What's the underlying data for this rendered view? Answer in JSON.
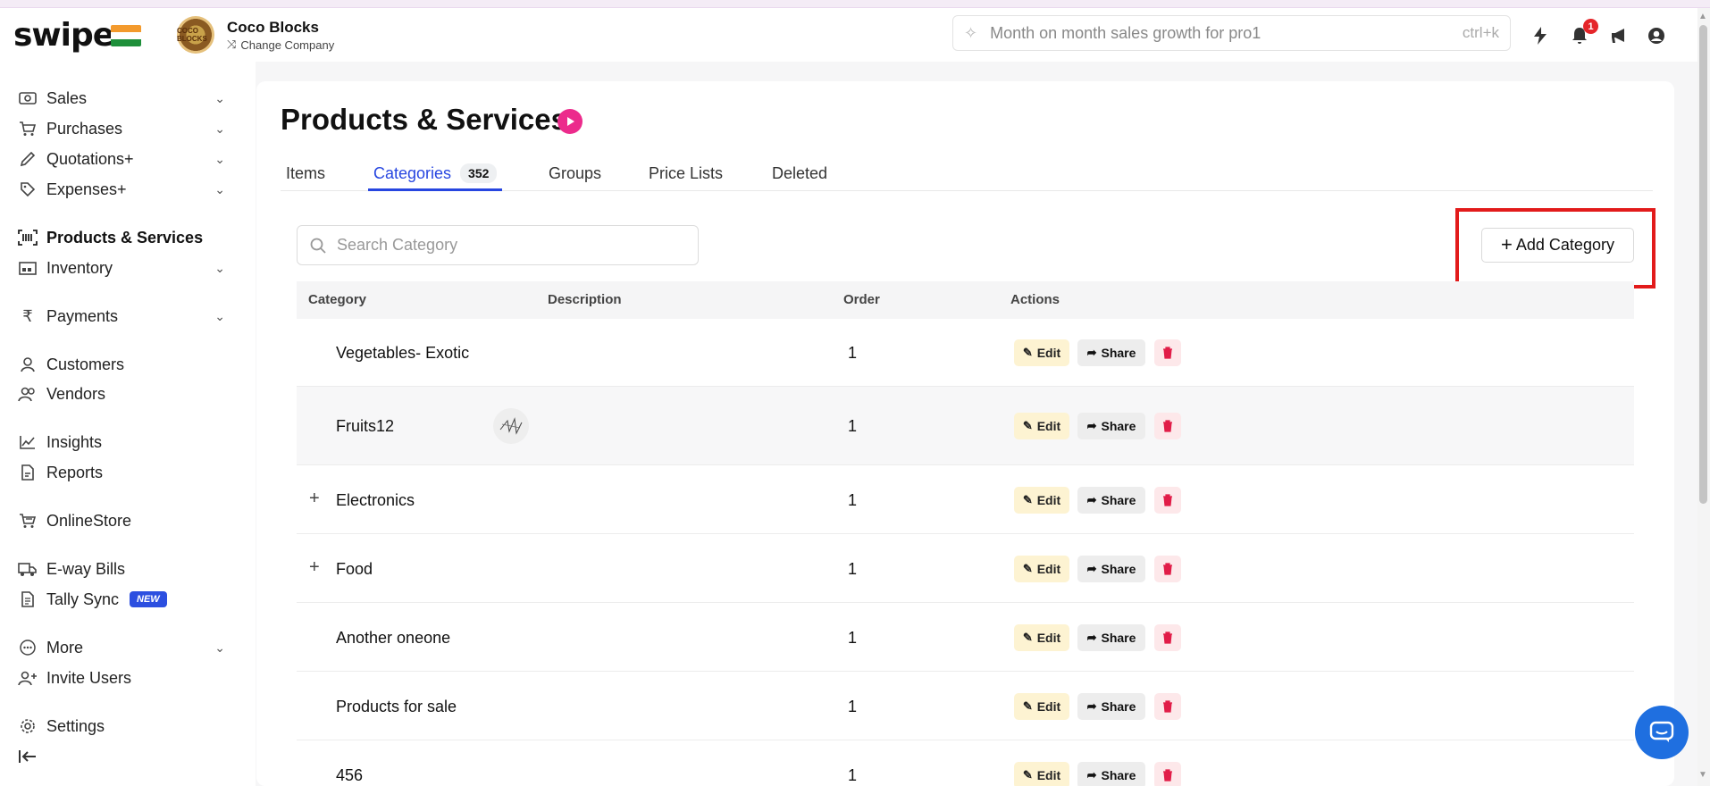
{
  "app": {
    "logo": "swipe",
    "company_name": "Coco Blocks",
    "company_logo_text": "COCO BLOCKS",
    "change_company": "Change Company",
    "search_placeholder": "Month on month sales growth for pro1",
    "search_shortcut": "ctrl+k",
    "notification_count": "1"
  },
  "sidebar": {
    "items": [
      {
        "label": "Sales",
        "icon": "cash-icon",
        "expandable": true
      },
      {
        "label": "Purchases",
        "icon": "cart-icon",
        "expandable": true
      },
      {
        "label": "Quotations+",
        "icon": "pen-icon",
        "expandable": true
      },
      {
        "label": "Expenses+",
        "icon": "tag-icon",
        "expandable": true
      },
      {
        "label": "Products & Services",
        "icon": "barcode-icon",
        "active": true
      },
      {
        "label": "Inventory",
        "icon": "warehouse-icon",
        "expandable": true
      },
      {
        "label": "Payments",
        "icon": "rupee-icon",
        "expandable": true
      },
      {
        "label": "Customers",
        "icon": "user-icon"
      },
      {
        "label": "Vendors",
        "icon": "users-icon"
      },
      {
        "label": "Insights",
        "icon": "chart-line-icon"
      },
      {
        "label": "Reports",
        "icon": "report-icon"
      },
      {
        "label": "OnlineStore",
        "icon": "store-icon"
      },
      {
        "label": "E-way Bills",
        "icon": "truck-icon"
      },
      {
        "label": "Tally Sync",
        "icon": "document-icon",
        "badge": "NEW"
      },
      {
        "label": "More",
        "icon": "more-icon",
        "expandable": true
      },
      {
        "label": "Invite Users",
        "icon": "user-plus-icon"
      },
      {
        "label": "Settings",
        "icon": "gear-icon"
      }
    ]
  },
  "page": {
    "title": "Products & Services",
    "tabs": [
      {
        "label": "Items"
      },
      {
        "label": "Categories",
        "count": "352",
        "active": true
      },
      {
        "label": "Groups"
      },
      {
        "label": "Price Lists"
      },
      {
        "label": "Deleted"
      }
    ],
    "search_placeholder": "Search Category",
    "add_button": "Add Category"
  },
  "table": {
    "columns": [
      "Category",
      "Description",
      "Order",
      "Actions"
    ],
    "action_labels": {
      "edit": "Edit",
      "share": "Share"
    },
    "rows": [
      {
        "category": "Vegetables- Exotic",
        "order": "1",
        "expandable": false
      },
      {
        "category": "Fruits12",
        "order": "1",
        "expandable": false,
        "has_image": true
      },
      {
        "category": "Electronics",
        "order": "1",
        "expandable": true
      },
      {
        "category": "Food",
        "order": "1",
        "expandable": true
      },
      {
        "category": "Another oneone",
        "order": "1",
        "expandable": false
      },
      {
        "category": "Products for sale",
        "order": "1",
        "expandable": false
      },
      {
        "category": "456",
        "order": "1",
        "expandable": false
      }
    ]
  },
  "colors": {
    "accent": "#2746e0",
    "brand_pink": "#ec2b8c",
    "highlight": "#e21b1b",
    "delete": "#e11d48",
    "edit_bg": "#fdf3d2"
  }
}
